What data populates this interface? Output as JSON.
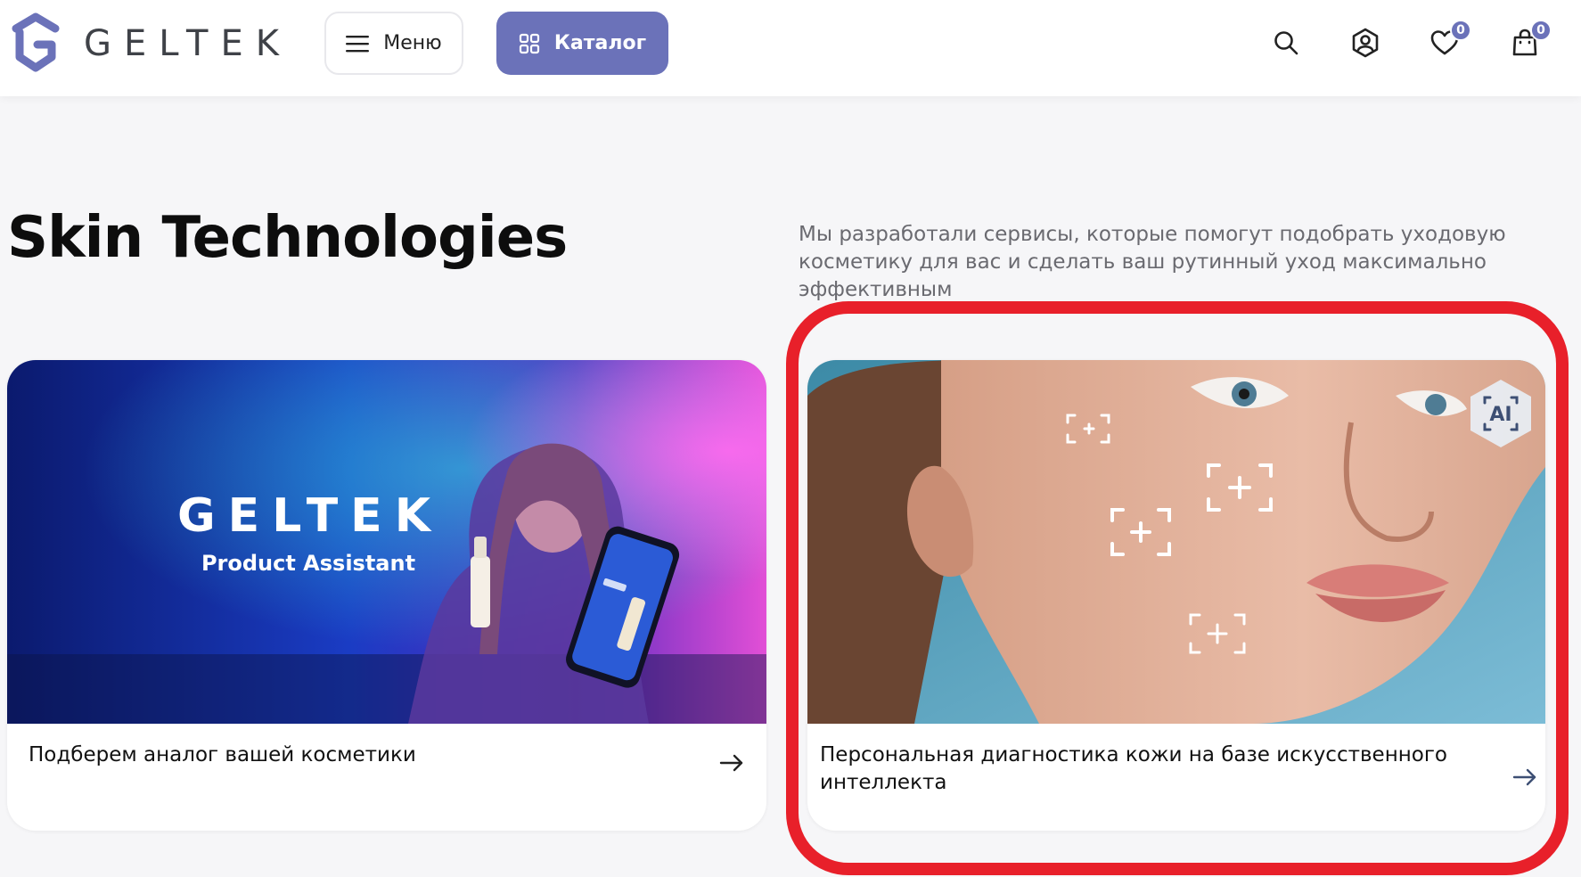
{
  "header": {
    "logo_text": "GELTEK",
    "menu_label": "Меню",
    "catalog_label": "Каталог",
    "favorites_count": "0",
    "cart_count": "0",
    "icons": [
      "search-icon",
      "user-icon",
      "heart-icon",
      "bag-icon"
    ]
  },
  "section": {
    "title": "Skin Technologies",
    "description": "Мы разработали сервисы, которые помогут подобрать уходовую косметику для вас и сделать ваш рутинный уход максимально эффективным"
  },
  "cards": [
    {
      "image_title": "GELTEK",
      "image_subtitle": "Product Assistant",
      "label": "Подберем аналог вашей косметики"
    },
    {
      "badge": "AI",
      "label": "Персональная диагностика кожи на базе искусственного интеллекта"
    }
  ],
  "colors": {
    "accent": "#6b72b9",
    "highlight": "#e8202a"
  }
}
